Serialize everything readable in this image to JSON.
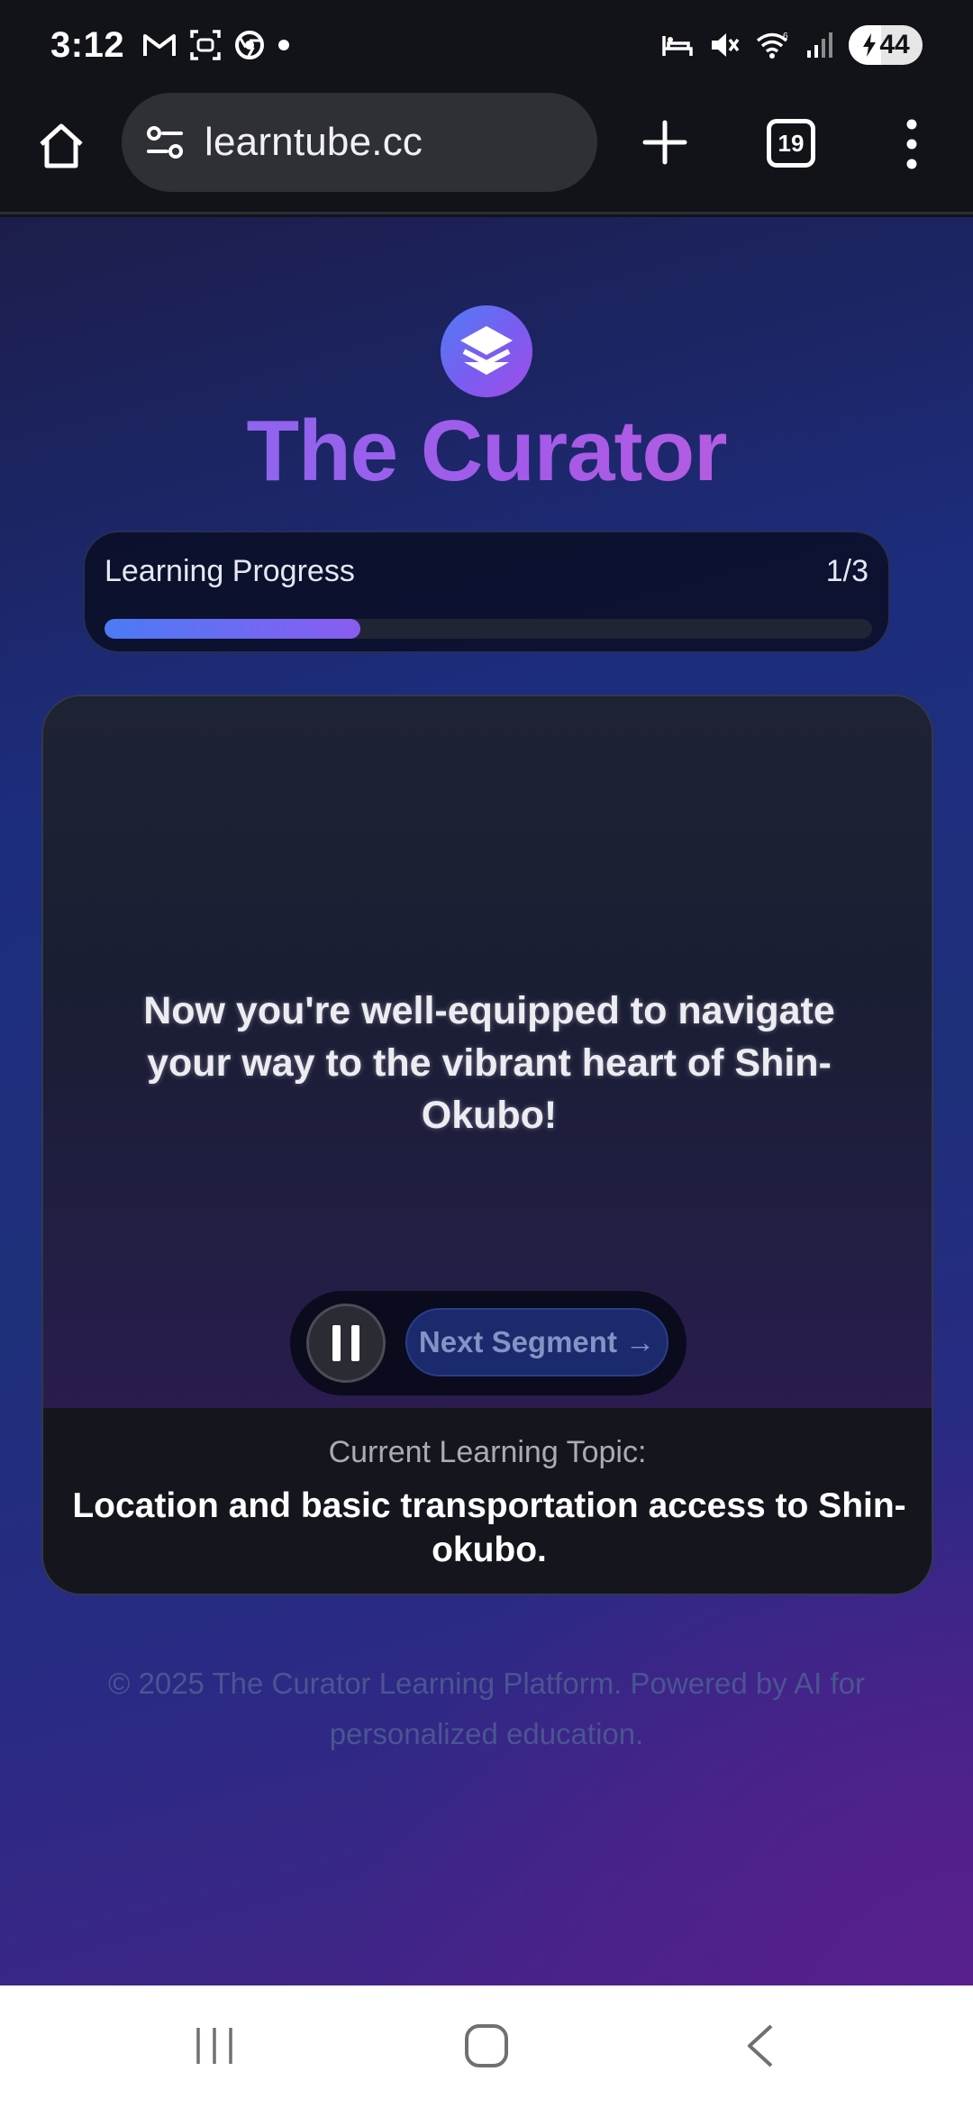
{
  "status_bar": {
    "time": "3:12",
    "battery": "44"
  },
  "browser": {
    "url": "learntube.cc",
    "tab_count": "19"
  },
  "app": {
    "title": "The Curator",
    "progress": {
      "label": "Learning Progress",
      "count": "1/3",
      "fraction": 0.333
    },
    "video": {
      "caption": "Now you're well-equipped to navigate your way to the vibrant heart of Shin-Okubo!",
      "next_label": "Next Segment →"
    },
    "topic": {
      "label": "Current Learning Topic:",
      "text": "Location and basic transportation access to Shin-okubo."
    },
    "footer": "© 2025 The Curator Learning Platform. Powered by AI for personalized education."
  },
  "colors": {
    "accent_blue": "#4b7bf5",
    "accent_purple": "#8a5cf0",
    "title_gradient_end": "#c85fd8"
  },
  "icons": [
    "gmail-icon",
    "screenshot-icon",
    "chrome-icon",
    "alarm-icon",
    "mute-icon",
    "wifi-icon",
    "signal-icon",
    "home-icon",
    "site-info-icon",
    "plus-icon",
    "menu-icon",
    "layers-icon",
    "pause-icon"
  ]
}
